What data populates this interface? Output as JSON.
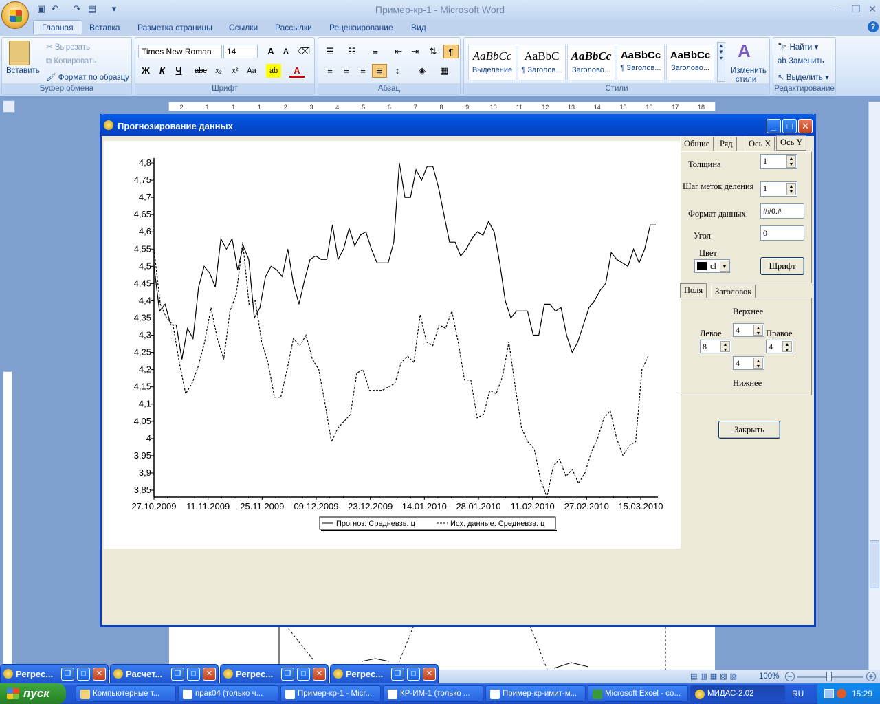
{
  "word": {
    "title": "Пример-кр-1 - Microsoft Word",
    "tabs": [
      "Главная",
      "Вставка",
      "Разметка страницы",
      "Ссылки",
      "Рассылки",
      "Рецензирование",
      "Вид"
    ],
    "clipboard": {
      "paste": "Вставить",
      "cut": "Вырезать",
      "copy": "Копировать",
      "format_painter": "Формат по образцу",
      "label": "Буфер обмена"
    },
    "font": {
      "name": "Times New Roman",
      "size": "14",
      "label": "Шрифт"
    },
    "paragraph_label": "Абзац",
    "styles": {
      "label": "Стили",
      "tiles": [
        {
          "sample": "AaBbCc",
          "name": "Выделение"
        },
        {
          "sample": "AaBbC",
          "name": "¶ Заголов..."
        },
        {
          "sample": "AaBbCc",
          "name": "Заголово..."
        },
        {
          "sample": "AaBbCc",
          "name": "¶ Заголов..."
        },
        {
          "sample": "AaBbCc",
          "name": "Заголово..."
        }
      ],
      "change": "Изменить стили"
    },
    "editing": {
      "find": "Найти",
      "replace": "Заменить",
      "select": "Выделить",
      "label": "Редактирование"
    },
    "ruler_numbers": [
      "2",
      "1",
      "1",
      "1",
      "2",
      "3",
      "4",
      "5",
      "6",
      "7",
      "8",
      "9",
      "10",
      "11",
      "12",
      "13",
      "14",
      "15",
      "16",
      "17",
      "18"
    ],
    "zoom": "100%"
  },
  "dialog": {
    "title": "Прогнозирование данных",
    "tabs_top": [
      "Общие",
      "Ряд",
      "Ось X",
      "Ось Y"
    ],
    "axis_y": {
      "thickness_label": "Толщина",
      "thickness": "1",
      "tick_step_label": "Шаг меток деления",
      "tick_step": "1",
      "format_label": "Формат данных",
      "format": "##0.#",
      "angle_label": "Угол",
      "angle": "0",
      "color_label": "Цвет",
      "color_value": "cl",
      "font_button": "Шрифт"
    },
    "tabs_bottom": [
      "Поля",
      "Заголовок"
    ],
    "margins": {
      "top_label": "Верхнее",
      "top": "4",
      "left_label": "Левое",
      "left": "8",
      "right_label": "Правое",
      "right": "4",
      "bottom_label": "Нижнее",
      "bottom": "4"
    },
    "close_button": "Закрыть"
  },
  "chart_data": {
    "type": "line",
    "x_tick_labels": [
      "27.10.2009",
      "11.11.2009",
      "25.11.2009",
      "09.12.2009",
      "23.12.2009",
      "14.01.2010",
      "28.01.2010",
      "11.02.2010",
      "27.02.2010",
      "15.03.2010"
    ],
    "y_tick_labels": [
      "4,8",
      "4,75",
      "4,7",
      "4,65",
      "4,6",
      "4,55",
      "4,5",
      "4,45",
      "4,4",
      "4,35",
      "4,3",
      "4,25",
      "4,2",
      "4,15",
      "4,1",
      "4,05",
      "4",
      "3,95",
      "3,9",
      "3,85"
    ],
    "ylim": [
      3.83,
      4.81
    ],
    "x_range_index": [
      0,
      139
    ],
    "grid": false,
    "legend_position": "bottom",
    "series": [
      {
        "name": "Прогноз: Средневзв. ц",
        "style": "solid",
        "values": [
          4.5,
          4.37,
          4.39,
          4.33,
          4.33,
          4.23,
          4.32,
          4.29,
          4.44,
          4.5,
          4.48,
          4.44,
          4.58,
          4.55,
          4.58,
          4.49,
          4.56,
          4.52,
          4.35,
          4.38,
          4.47,
          4.5,
          4.49,
          4.47,
          4.55,
          4.45,
          4.39,
          4.46,
          4.52,
          4.53,
          4.52,
          4.52,
          4.62,
          4.52,
          4.55,
          4.61,
          4.56,
          4.59,
          4.6,
          4.55,
          4.51,
          4.51,
          4.51,
          4.57,
          4.8,
          4.7,
          4.7,
          4.78,
          4.75,
          4.79,
          4.79,
          4.73,
          4.65,
          4.57,
          4.57,
          4.53,
          4.55,
          4.58,
          4.6,
          4.59,
          4.63,
          4.6,
          4.51,
          4.4,
          4.35,
          4.37,
          4.37,
          4.37,
          4.3,
          4.3,
          4.39,
          4.39,
          4.37,
          4.38,
          4.3,
          4.25,
          4.28,
          4.33,
          4.38,
          4.4,
          4.43,
          4.45,
          4.54,
          4.52,
          4.51,
          4.5,
          4.55,
          4.51,
          4.55,
          4.62,
          4.62
        ]
      },
      {
        "name": "Исх. данные: Средневзв. ц",
        "style": "dashed",
        "values": [
          4.55,
          4.39,
          4.35,
          4.33,
          4.22,
          4.13,
          4.16,
          4.21,
          4.28,
          4.38,
          4.29,
          4.23,
          4.37,
          4.42,
          4.57,
          4.39,
          4.4,
          4.28,
          4.22,
          4.12,
          4.12,
          4.2,
          4.29,
          4.27,
          4.3,
          4.23,
          4.2,
          4.1,
          3.99,
          4.03,
          4.05,
          4.07,
          4.19,
          4.2,
          4.14,
          4.14,
          4.14,
          4.15,
          4.16,
          4.22,
          4.24,
          4.22,
          4.36,
          4.28,
          4.27,
          4.33,
          4.32,
          4.37,
          4.28,
          4.17,
          4.17,
          4.06,
          4.07,
          4.14,
          4.13,
          4.18,
          4.28,
          4.15,
          4.03,
          3.99,
          3.97,
          3.88,
          3.83,
          3.92,
          3.94,
          3.89,
          3.91,
          3.87,
          3.9,
          3.96,
          4.0,
          4.06,
          4.08,
          4.0,
          3.95,
          3.98,
          3.99,
          4.2,
          4.24
        ]
      }
    ]
  },
  "status": {
    "minimized": [
      "Регрес...",
      "Расчет...",
      "Регрес...",
      "Регрес..."
    ]
  },
  "taskbar": {
    "start": "пуск",
    "items": [
      "Компьютерные т...",
      "прак04 (только ч...",
      "Пример-кр-1 - Micr...",
      "КР-ИМ-1 (только ...",
      "Пример-кр-имит-м...",
      "Microsoft Excel - со...",
      "МИДАС-2.02"
    ],
    "lang": "RU",
    "time": "15:29"
  }
}
